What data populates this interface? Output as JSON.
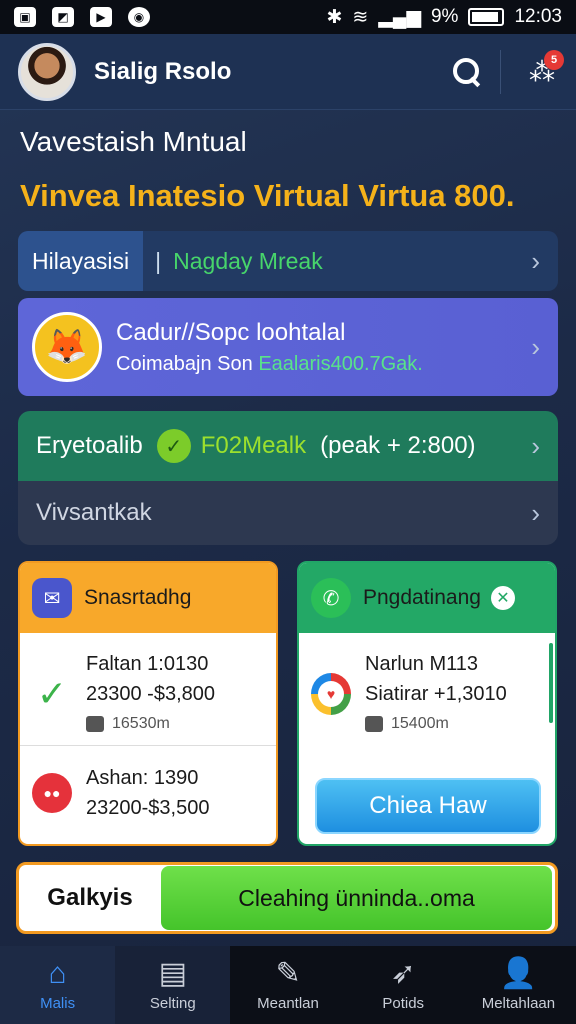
{
  "status_bar": {
    "left_icons": [
      "image-icon",
      "photo-icon",
      "video-icon",
      "location-icon"
    ],
    "battery_text": "9%",
    "time": "12:03"
  },
  "header": {
    "username": "Sialig Rsolo",
    "notification_count": "5"
  },
  "headline": {
    "title": "Vavestaish Mntual",
    "subtitle": "Vinvea Inatesio Virtual Virtua 800."
  },
  "rows": {
    "row_a": {
      "pill": "Hilayasisi",
      "separator": "|",
      "highlight": "Nagday Mreak"
    },
    "row_b": {
      "title": "Cadur//Sopc loohtalal",
      "sub_prefix": "Coimabajn Son",
      "sub_highlight": "Eaalaris400.7Gak."
    },
    "row_c": {
      "label": "Eryetoalib",
      "highlight": "F02Mealk",
      "detail": "(peak + 2:800)"
    },
    "row_d": {
      "label": "Vivsantkak"
    }
  },
  "card_left": {
    "title": "Snasrtadhg",
    "entries": [
      {
        "line1": "Faltan 1:0130",
        "line2": "23300 -$3,800",
        "sub": "16530m"
      },
      {
        "line1": "Ashan: 1390",
        "line2": "23200-$3,500"
      }
    ]
  },
  "card_right": {
    "title": "Pngdatinang",
    "entry": {
      "line1": "Narlun M113",
      "line2": "Siatirar +1,3010",
      "sub": "15400m"
    },
    "button": "Chiea Haw"
  },
  "action": {
    "label": "Galkyis",
    "button": "Cleahing ünninda..oma"
  },
  "nav": [
    {
      "label": "Malis",
      "icon": "home-icon"
    },
    {
      "label": "Selting",
      "icon": "document-icon"
    },
    {
      "label": "Meantlan",
      "icon": "edit-icon"
    },
    {
      "label": "Potids",
      "icon": "rocket-icon"
    },
    {
      "label": "Meltahlaan",
      "icon": "profile-icon"
    }
  ],
  "colors": {
    "accent_orange": "#f29a21",
    "accent_green": "#23a866",
    "accent_purple": "#5e66d8",
    "title_yellow": "#f5b21a",
    "nav_active": "#3f90f5"
  }
}
